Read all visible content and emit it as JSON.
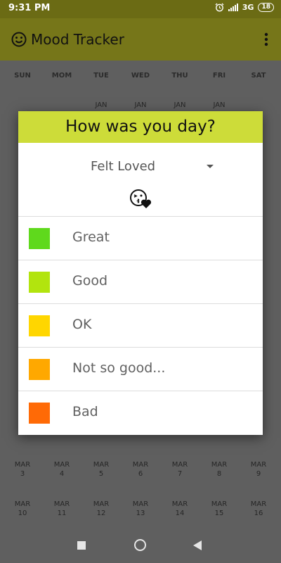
{
  "status_bar": {
    "time": "9:31 PM",
    "network": "3G",
    "battery": "18"
  },
  "app_bar": {
    "title": "Mood Tracker"
  },
  "calendar": {
    "days_of_week": [
      "SUN",
      "MOM",
      "TUE",
      "WED",
      "THU",
      "FRI",
      "SAT"
    ],
    "top_row_months": [
      "JAN",
      "JAN",
      "JAN",
      "JAN"
    ],
    "rows": [
      {
        "month": "MAR",
        "days": [
          "3",
          "4",
          "5",
          "6",
          "7",
          "8",
          "9"
        ]
      },
      {
        "month": "MAR",
        "days": [
          "10",
          "11",
          "12",
          "13",
          "14",
          "15",
          "16"
        ]
      }
    ]
  },
  "dialog": {
    "title": "How was you day?",
    "selected": "Felt Loved",
    "selected_icon": "kiss-face-icon",
    "options": [
      {
        "label": "Great",
        "color": "#5fd91c"
      },
      {
        "label": "Good",
        "color": "#b2e40e"
      },
      {
        "label": "OK",
        "color": "#ffd600"
      },
      {
        "label": "Not so good...",
        "color": "#ffa800"
      },
      {
        "label": "Bad",
        "color": "#ff6a06"
      }
    ]
  }
}
